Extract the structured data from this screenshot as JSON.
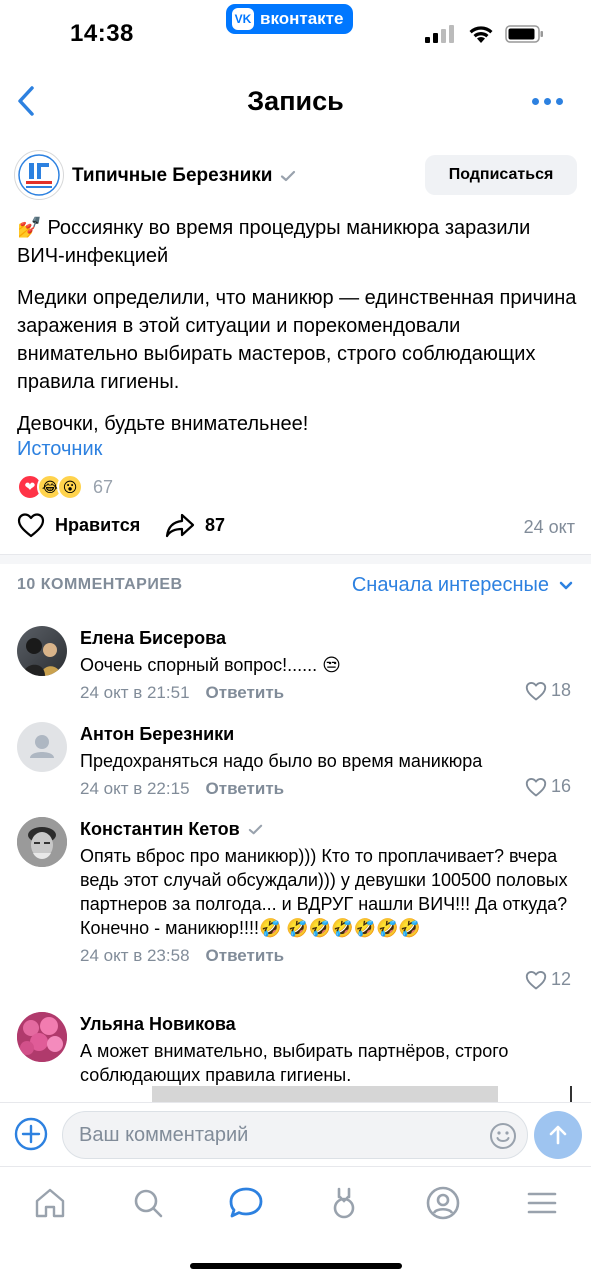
{
  "status_bar": {
    "time": "14:38",
    "app_badge": "вконтакте"
  },
  "nav": {
    "title": "Запись"
  },
  "post": {
    "group_name": "Типичные Березники",
    "subscribe_label": "Подписаться",
    "emoji_prefix": "💅",
    "headline": "Россиянку во время процедуры маникюра заразили ВИЧ-инфекцией",
    "paragraph": "Медики определили, что маникюр — единственная причина заражения в этой ситуации и порекомендовали внимательно выбирать мастеров, строго соблюдающих правила гигиены.",
    "closing": "Девочки, будьте внимательнее!",
    "source_label": "Источник",
    "reactions": [
      "❤",
      "😂",
      "😮"
    ],
    "reaction_count": "67",
    "like_label": "Нравится",
    "share_count": "87",
    "date": "24 окт"
  },
  "comments_header": {
    "count_label": "10 КОММЕНТАРИЕВ",
    "sort_label": "Сначала интересные"
  },
  "comments": [
    {
      "author": "Елена Бисерова",
      "text": "Оочень спорный вопрос!...... 😒",
      "time": "24 окт в 21:51",
      "reply": "Ответить",
      "likes": "18"
    },
    {
      "author": "Антон Березники",
      "text": "Предохраняться надо было во время маникюра",
      "time": "24 окт в 22:15",
      "reply": "Ответить",
      "likes": "16"
    },
    {
      "author": "Константин Кетов",
      "text": "Опять вброс про маникюр))) Кто то проплачивает? вчера ведь этот случай обсуждали))) у девушки 100500 половых партнеров за полгода... и ВДРУГ нашли ВИЧ!!! Да откуда? Конечно - маникюр!!!!🤣 🤣🤣🤣🤣🤣🤣",
      "time": "24 окт в 23:58",
      "reply": "Ответить",
      "likes": "12"
    },
    {
      "author": "Ульяна Новикова",
      "text": "А может внимательно, выбирать партнёров, строго соблюдающих правила гигиены."
    }
  ],
  "composer": {
    "placeholder": "Ваш комментарий"
  },
  "colors": {
    "accent": "#2d81e0",
    "vk_blue": "#0077ff",
    "muted": "#818c99"
  }
}
